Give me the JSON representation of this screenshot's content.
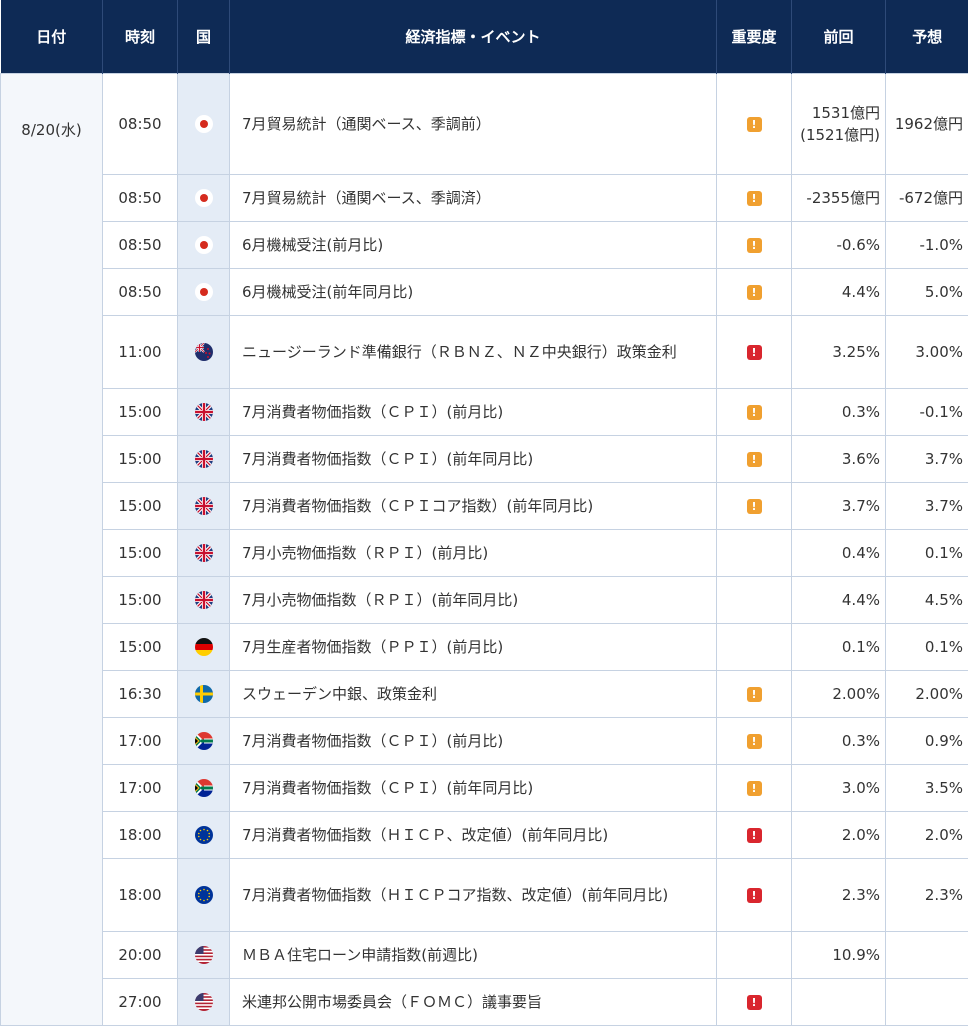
{
  "headers": {
    "date": "日付",
    "time": "時刻",
    "country": "国",
    "event": "経済指標・イベント",
    "importance": "重要度",
    "previous": "前回",
    "forecast": "予想"
  },
  "date": "8/20(水)",
  "importance_badge": "!",
  "colors": {
    "header_bg": "#0e2a55",
    "importance_medium": "#f0a030",
    "importance_high": "#d9262e",
    "country_cell_bg": "#e4ecf6"
  },
  "rows": [
    {
      "time": "08:50",
      "country": "japan",
      "event": "7月貿易統計（通関ベース、季調前）",
      "importance": "medium",
      "previous": "1531億円(1521億円)",
      "forecast": "1962億円"
    },
    {
      "time": "08:50",
      "country": "japan",
      "event": "7月貿易統計（通関ベース、季調済）",
      "importance": "medium",
      "previous": "-2355億円",
      "forecast": "-672億円"
    },
    {
      "time": "08:50",
      "country": "japan",
      "event": "6月機械受注(前月比)",
      "importance": "medium",
      "previous": "-0.6%",
      "forecast": "-1.0%"
    },
    {
      "time": "08:50",
      "country": "japan",
      "event": "6月機械受注(前年同月比)",
      "importance": "medium",
      "previous": "4.4%",
      "forecast": "5.0%"
    },
    {
      "time": "11:00",
      "country": "new-zealand",
      "event": "ニュージーランド準備銀行（ＲＢＮＺ、ＮＺ中央銀行）政策金利",
      "importance": "high",
      "previous": "3.25%",
      "forecast": "3.00%"
    },
    {
      "time": "15:00",
      "country": "uk",
      "event": "7月消費者物価指数（ＣＰＩ）(前月比)",
      "importance": "medium",
      "previous": "0.3%",
      "forecast": "-0.1%"
    },
    {
      "time": "15:00",
      "country": "uk",
      "event": "7月消費者物価指数（ＣＰＩ）(前年同月比)",
      "importance": "medium",
      "previous": "3.6%",
      "forecast": "3.7%"
    },
    {
      "time": "15:00",
      "country": "uk",
      "event": "7月消費者物価指数（ＣＰＩコア指数）(前年同月比)",
      "importance": "medium",
      "previous": "3.7%",
      "forecast": "3.7%"
    },
    {
      "time": "15:00",
      "country": "uk",
      "event": "7月小売物価指数（ＲＰＩ）(前月比)",
      "importance": "",
      "previous": "0.4%",
      "forecast": "0.1%"
    },
    {
      "time": "15:00",
      "country": "uk",
      "event": "7月小売物価指数（ＲＰＩ）(前年同月比)",
      "importance": "",
      "previous": "4.4%",
      "forecast": "4.5%"
    },
    {
      "time": "15:00",
      "country": "germany",
      "event": "7月生産者物価指数（ＰＰＩ）(前月比)",
      "importance": "",
      "previous": "0.1%",
      "forecast": "0.1%"
    },
    {
      "time": "16:30",
      "country": "sweden",
      "event": "スウェーデン中銀、政策金利",
      "importance": "medium",
      "previous": "2.00%",
      "forecast": "2.00%"
    },
    {
      "time": "17:00",
      "country": "south-africa",
      "event": "7月消費者物価指数（ＣＰＩ）(前月比)",
      "importance": "medium",
      "previous": "0.3%",
      "forecast": "0.9%"
    },
    {
      "time": "17:00",
      "country": "south-africa",
      "event": "7月消費者物価指数（ＣＰＩ）(前年同月比)",
      "importance": "medium",
      "previous": "3.0%",
      "forecast": "3.5%"
    },
    {
      "time": "18:00",
      "country": "eurozone",
      "event": "7月消費者物価指数（ＨＩＣＰ、改定値）(前年同月比)",
      "importance": "high",
      "previous": "2.0%",
      "forecast": "2.0%"
    },
    {
      "time": "18:00",
      "country": "eurozone",
      "event": "7月消費者物価指数（ＨＩＣＰコア指数、改定値）(前年同月比)",
      "importance": "high",
      "previous": "2.3%",
      "forecast": "2.3%"
    },
    {
      "time": "20:00",
      "country": "us",
      "event": "ＭＢＡ住宅ローン申請指数(前週比)",
      "importance": "",
      "previous": "10.9%",
      "forecast": ""
    },
    {
      "time": "27:00",
      "country": "us",
      "event": "米連邦公開市場委員会（ＦＯＭＣ）議事要旨",
      "importance": "high",
      "previous": "",
      "forecast": ""
    }
  ]
}
